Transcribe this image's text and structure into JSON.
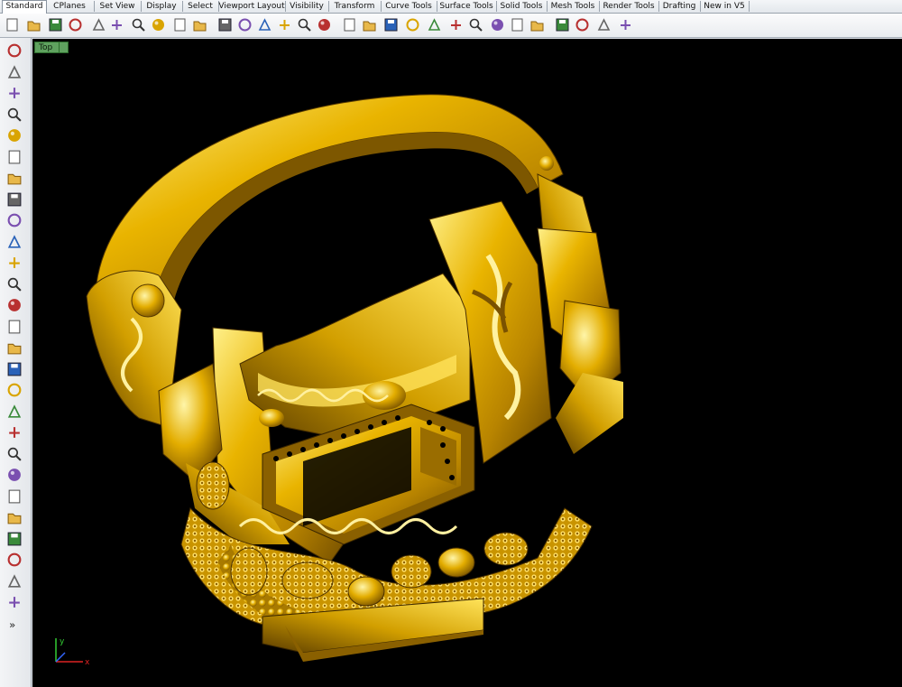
{
  "tabs": [
    {
      "label": "Standard",
      "active": true
    },
    {
      "label": "CPlanes"
    },
    {
      "label": "Set View"
    },
    {
      "label": "Display"
    },
    {
      "label": "Select"
    },
    {
      "label": "Viewport Layout"
    },
    {
      "label": "Visibility"
    },
    {
      "label": "Transform"
    },
    {
      "label": "Curve Tools"
    },
    {
      "label": "Surface Tools"
    },
    {
      "label": "Solid Tools"
    },
    {
      "label": "Mesh Tools"
    },
    {
      "label": "Render Tools"
    },
    {
      "label": "Drafting"
    },
    {
      "label": "New in V5"
    }
  ],
  "toolbar_icons": [
    "new-file-icon",
    "open-folder-icon",
    "save-icon",
    "print-icon",
    "copy-to-clipboard-icon",
    "cut-icon",
    "copy-icon",
    "paste-icon",
    "undo-icon",
    "pan-hand-icon",
    "move-arrows-icon",
    "zoom-icon",
    "zoom-window-icon",
    "zoom-extents-icon",
    "zoom-selected-icon",
    "four-viewports-icon",
    "car-icon",
    "hide-icon",
    "show-icon",
    "lightbulb-icon",
    "lock-icon",
    "render-color-icon",
    "color-wheel-icon",
    "shaded-sphere-icon",
    "rendered-sphere-icon",
    "globe-icon",
    "options-icon",
    "settings-gear-icon",
    "snap-icon",
    "help-icon"
  ],
  "left_tools": [
    "select-arrow-icon",
    "point-icon",
    "polyline-icon",
    "curve-icon",
    "circle-icon",
    "ellipse-icon",
    "polygon-icon",
    "rectangle-icon",
    "arc-icon",
    "fillet-curve-icon",
    "surface-icon",
    "extrude-icon",
    "box-icon",
    "sphere-icon",
    "cylinder-icon",
    "mesh-icon",
    "boolean-icon",
    "split-icon",
    "move-icon",
    "solid-tools-icon",
    "array-icon",
    "bend-icon",
    "text-icon",
    "dimension-icon",
    "group-icon",
    "block-icon",
    "layer-icon",
    "more-icon"
  ],
  "viewport": {
    "name": "Top",
    "background": "#000000",
    "model_color": "#e0a800",
    "axis_labels": {
      "x": "x",
      "y": "y"
    }
  }
}
